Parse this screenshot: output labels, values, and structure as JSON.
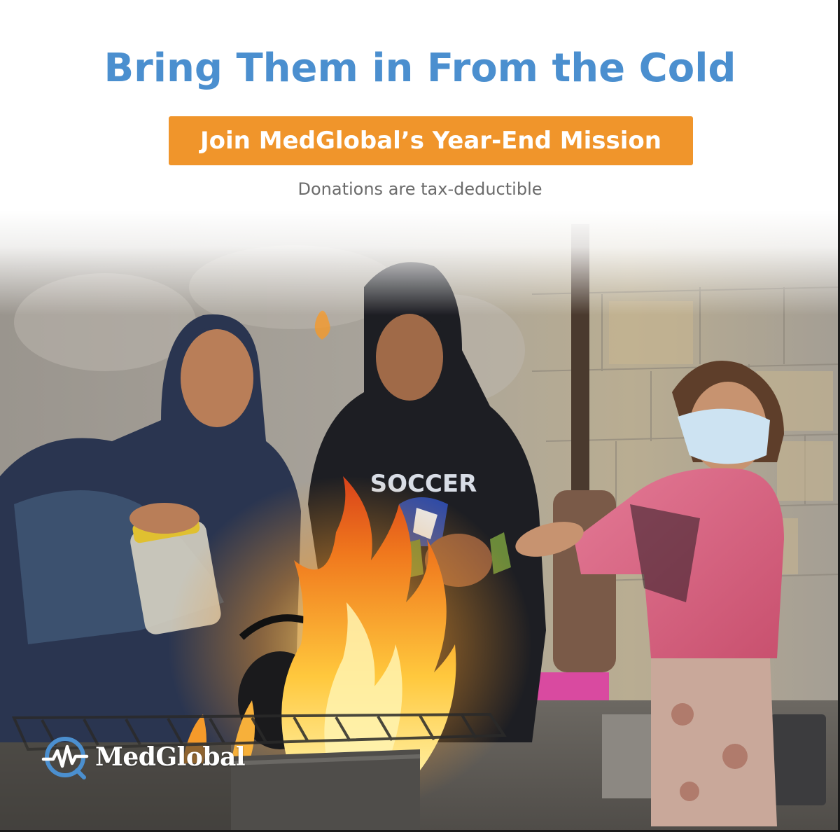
{
  "headline": "Bring Them in From the Cold",
  "banner": "Join MedGlobal’s Year-End Mission",
  "subtext": "Donations are tax-deductible",
  "photo": {
    "sweatshirt_text": "SOCCER"
  },
  "logo": {
    "name": "MedGlobal",
    "icon": "heartbeat-globe-icon"
  },
  "colors": {
    "headline": "#4b8fcf",
    "banner_bg": "#f0952b",
    "banner_text": "#ffffff",
    "subtext": "#6b6b6b",
    "logo_accent": "#4b8fcf"
  }
}
